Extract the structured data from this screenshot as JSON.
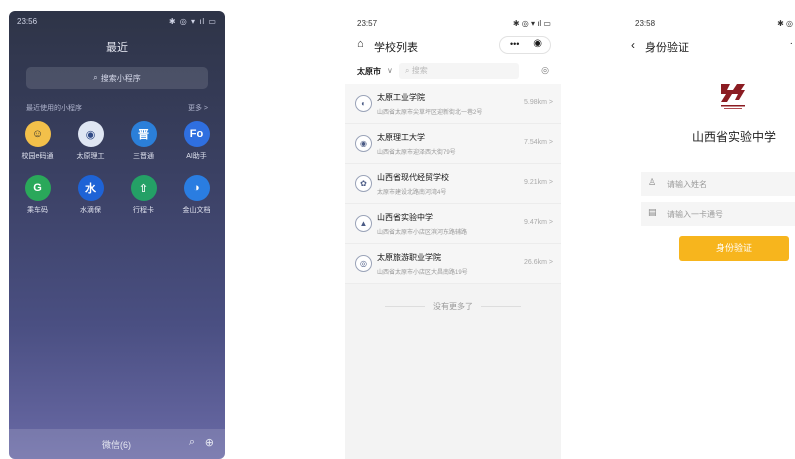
{
  "screen1": {
    "status_time": "23:56",
    "status_icons": "✱ ◎ ▾ ıl ▭",
    "title": "最近",
    "search_placeholder": "搜索小程序",
    "recent_label": "最近使用的小程序",
    "more_label": "更多 >",
    "apps": [
      {
        "label": "校园e码通",
        "icon": "smiley-icon",
        "glyph": "☺",
        "color": "#f3c04a",
        "fg": "#2b2b2b"
      },
      {
        "label": "太原理工",
        "icon": "university-emblem-icon",
        "glyph": "◉",
        "color": "#dfe6f3",
        "fg": "#304a86"
      },
      {
        "label": "三晋通",
        "icon": "sanjintong-icon",
        "glyph": "晋",
        "color": "#2b7fd9",
        "fg": "#ffffff"
      },
      {
        "label": "AI助手",
        "icon": "ai-assistant-icon",
        "glyph": "Fo",
        "color": "#2f6fe0",
        "fg": "#ffffff"
      },
      {
        "label": "乘车码",
        "icon": "bus-code-icon",
        "glyph": "G",
        "color": "#2aa85a",
        "fg": "#ffffff"
      },
      {
        "label": "水滴保",
        "icon": "shuidibao-icon",
        "glyph": "水",
        "color": "#1e63d6",
        "fg": "#ffffff"
      },
      {
        "label": "行程卡",
        "icon": "travel-card-icon",
        "glyph": "⇧",
        "color": "#24a066",
        "fg": "#ffffff"
      },
      {
        "label": "金山文档",
        "icon": "kingsoft-docs-icon",
        "glyph": "◑",
        "color": "#2a7de1",
        "fg": "#ffffff"
      }
    ],
    "bottom_label": "微信(6)"
  },
  "screen2": {
    "status_time": "23:57",
    "status_icons": "✱ ◎ ▾ ıl ▭",
    "title": "学校列表",
    "capsule_menu": "•••",
    "capsule_close": "◉",
    "city": "太原市",
    "search_placeholder": "搜索",
    "schools": [
      {
        "name": "太原工业学院",
        "address": "山西省太原市尖草坪区迎新街北一巷2号",
        "distance": "5.98km >"
      },
      {
        "name": "太原理工大学",
        "address": "山西省太原市迎泽西大街79号",
        "distance": "7.54km >"
      },
      {
        "name": "山西省现代经贸学校",
        "address": "太原市建设北路南河湾4号",
        "distance": "9.21km >"
      },
      {
        "name": "山西省实验中学",
        "address": "山西省太原市小店区滨河东路辅路",
        "distance": "9.47km >"
      },
      {
        "name": "太原旅游职业学院",
        "address": "山西省太原市小店区大昌南路19号",
        "distance": "26.6km >"
      }
    ],
    "no_more": "没有更多了"
  },
  "screen3": {
    "status_time": "23:58",
    "status_icons": "✱ ◎",
    "title": "身份验证",
    "school_name": "山西省实验中学",
    "name_placeholder": "请输入姓名",
    "card_placeholder": "请输入一卡通号",
    "verify_button": "身份验证",
    "brand_color": "#f7b51d"
  }
}
